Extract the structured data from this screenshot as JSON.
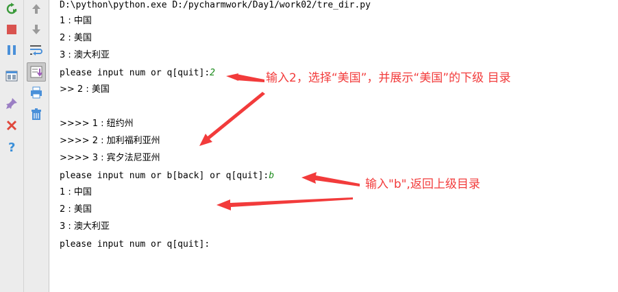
{
  "console": {
    "lines": [
      {
        "text": "D:\\python\\python.exe D:/pycharmwork/Day1/work02/tre_dir.py",
        "echo": ""
      },
      {
        "text": "1 : 中国",
        "echo": ""
      },
      {
        "text": "2 : 美国",
        "echo": ""
      },
      {
        "text": "3 : 澳大利亚",
        "echo": ""
      },
      {
        "text": "please input num or q[quit]:",
        "echo": "2"
      },
      {
        "text": ">> 2 : 美国",
        "echo": ""
      },
      {
        "text": "",
        "echo": ""
      },
      {
        "text": ">>>> 1 : 纽约州",
        "echo": ""
      },
      {
        "text": ">>>> 2 : 加利福利亚州",
        "echo": ""
      },
      {
        "text": ">>>> 3 : 宾夕法尼亚州",
        "echo": ""
      },
      {
        "text": "please input num or b[back] or q[quit]:",
        "echo": "b"
      },
      {
        "text": "1 : 中国",
        "echo": ""
      },
      {
        "text": "2 : 美国",
        "echo": ""
      },
      {
        "text": "3 : 澳大利亚",
        "echo": ""
      },
      {
        "text": "please input num or q[quit]:",
        "echo": ""
      }
    ]
  },
  "annotations": {
    "first": "输入2，选择“美国”，并展示“美国”的下级 目录",
    "second": "输入\"b\",返回上级目录"
  },
  "toolbar": {
    "left": [
      "rerun-icon",
      "stop-icon",
      "pause-icon",
      "layout-icon",
      "pin-icon",
      "close-icon",
      "help-icon"
    ],
    "right": [
      "up-arrow-icon",
      "down-arrow-icon",
      "soft-wrap-icon",
      "scroll-to-end-icon",
      "print-icon",
      "trash-icon"
    ]
  },
  "colors": {
    "annotation": "#f23b3b",
    "input_echo": "#1a8a1a",
    "toolbar_bg": "#ececec"
  }
}
